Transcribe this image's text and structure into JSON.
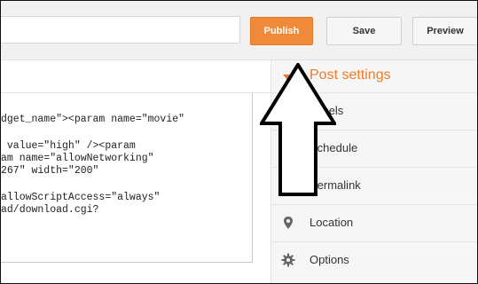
{
  "toolbar": {
    "publish_label": "Publish",
    "save_label": "Save",
    "preview_label": "Preview"
  },
  "editor": {
    "code_lines": [
      "dget_name\">&lt;param name=\"movie\"",
      " value=\"high\" />&lt;param",
      "am name=\"allowNetworking\"",
      "267\" width=\"200\"",
      "allowScriptAccess=\"always\"",
      "ad/download.cgi?"
    ]
  },
  "sidebar": {
    "title": "Post settings",
    "items": [
      {
        "label": "Labels",
        "icon": "label-tag-icon"
      },
      {
        "label": "Schedule",
        "icon": "clock-icon"
      },
      {
        "label": "Permalink",
        "icon": "link-icon"
      },
      {
        "label": "Location",
        "icon": "location-pin-icon"
      },
      {
        "label": "Options",
        "icon": "gear-icon"
      }
    ]
  },
  "colors": {
    "accent": "#ec7d2a",
    "publish_bg": "#f08a3a"
  }
}
